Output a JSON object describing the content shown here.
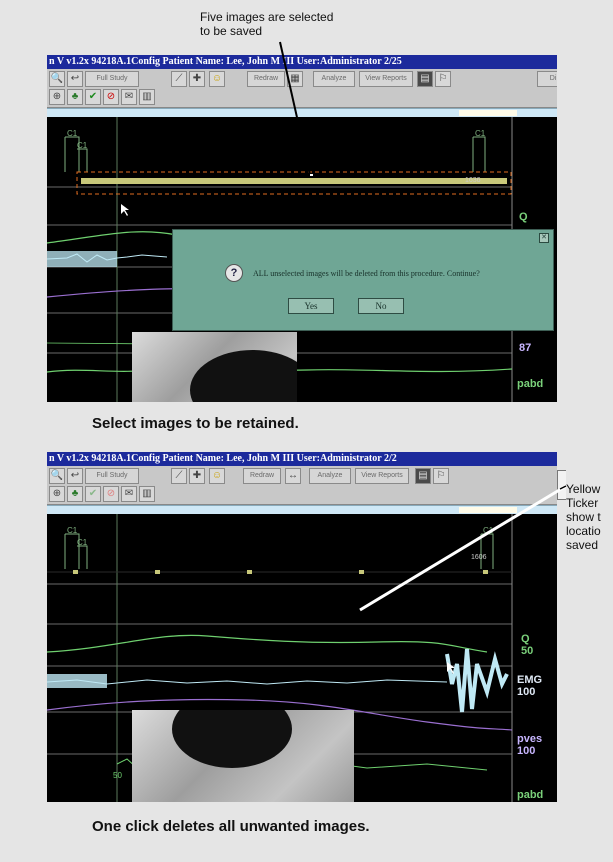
{
  "annotations": {
    "top_note_line1": "Five images are selected",
    "top_note_line2": "to be saved",
    "right_note": [
      "Yellow",
      "Ticker",
      "show t",
      "locatio",
      "saved"
    ]
  },
  "captions": {
    "top": "Select images to be retained.",
    "bottom": "One click deletes all unwanted images."
  },
  "screen1": {
    "title": "n V  v1.2x  94218A.1Config   Patient Name: Lee, John M  III   User:Administrator  2/25",
    "toolbar": {
      "full_study": "Full Study",
      "redraw": "Redraw",
      "analyze": "Analyze",
      "view_reports": "View Reports",
      "partial_button": "Di"
    },
    "markers": {
      "left_top": "C1",
      "left_bottom": "C1",
      "right": "C1",
      "time": "1636"
    },
    "side_labels": {
      "q": "Q",
      "pressure": "87",
      "abd": "pabd"
    },
    "dialog": {
      "message": "ALL unselected images will be deleted from this procedure.  Continue?",
      "yes": "Yes",
      "no": "No"
    }
  },
  "screen2": {
    "title": "n V  v1.2x  94218A.1Config   Patient Name: Lee, John M  III   User:Administrator  2/2",
    "toolbar": {
      "full_study": "Full Study",
      "redraw": "Redraw",
      "analyze": "Analyze",
      "view_reports": "View Reports"
    },
    "markers": {
      "left_top": "C1",
      "left_bottom": "C1",
      "right": "C1",
      "time": "1606"
    },
    "side_labels": {
      "q": "Q",
      "q_val": "50",
      "emg": "EMG",
      "emg_val": "100",
      "pves": "pves",
      "pves_val": "100",
      "abd": "pabd"
    }
  },
  "colors": {
    "titlebar": "#1c2a9c",
    "dialog": "#6fa695",
    "selection_box": "#e06d1f",
    "ticker": "#c8c87a",
    "trace_green": "#6fd06f",
    "trace_purple": "#9a6fd0",
    "emg": "#bfe9f5"
  }
}
